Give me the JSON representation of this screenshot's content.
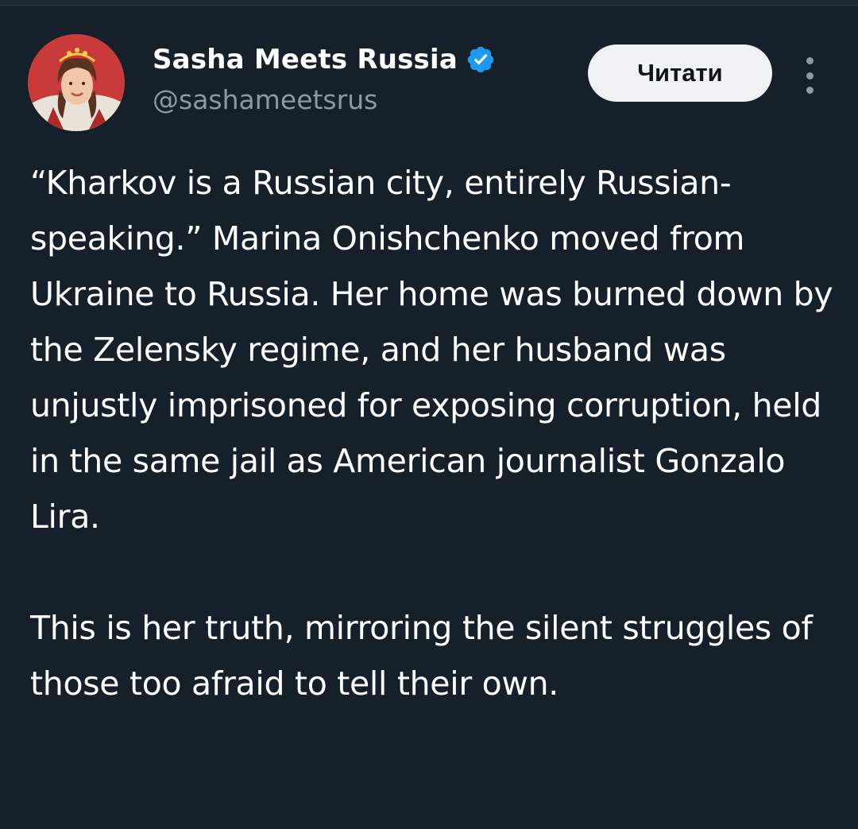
{
  "author": {
    "display_name": "Sasha Meets Russia",
    "handle": "@sashameetsrus",
    "verified": true,
    "avatar_icon": "avatar-photo-woman-traditional-headdress"
  },
  "actions": {
    "follow_label": "Читати",
    "more_icon": "more-vertical-icon"
  },
  "tweet": {
    "paragraphs": [
      "“Kharkov is a Russian city, entirely Russian-speaking.” Marina Onishchenko moved from Ukraine to Russia. Her home was burned down by the Zelensky regime, and her husband was unjustly imprisoned for exposing corruption, held in the same jail as American journalist Gonzalo Lira.",
      "This is her truth, mirroring the silent struggles of those too afraid to tell their own."
    ]
  },
  "colors": {
    "background": "#15202b",
    "text_primary": "#ffffff",
    "text_secondary": "#8b98a5",
    "verified_badge": "#1d9bf0",
    "button_bg": "#eff3f4",
    "button_text": "#0f1419"
  }
}
